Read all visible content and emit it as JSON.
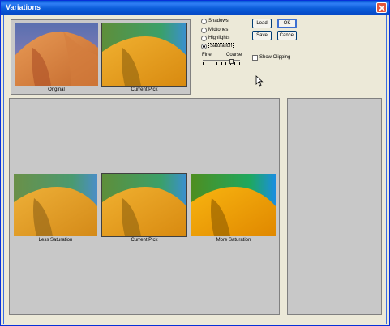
{
  "window": {
    "title": "Variations"
  },
  "top_thumbs": [
    {
      "caption": "Original"
    },
    {
      "caption": "Current Pick"
    }
  ],
  "adjust_options": [
    {
      "label": "Shadows",
      "checked": false
    },
    {
      "label": "Midtones",
      "checked": false
    },
    {
      "label": "Highlights",
      "checked": false
    },
    {
      "label": "Saturation",
      "checked": true
    }
  ],
  "buttons": {
    "load": "Load",
    "ok": "OK",
    "save": "Save",
    "cancel": "Cancel"
  },
  "slider": {
    "fine_label": "Fine",
    "coarse_label": "Coarse",
    "level": 0.8
  },
  "show_clipping": {
    "label": "Show Clipping",
    "checked": false
  },
  "main_thumbs": [
    {
      "caption": "Less Saturation"
    },
    {
      "caption": "Current Pick"
    },
    {
      "caption": "More Saturation"
    }
  ],
  "colors": {
    "title_bar": "#0a5bd8",
    "panel_bg": "#c8c8c8",
    "window_bg": "#ece9d8"
  }
}
